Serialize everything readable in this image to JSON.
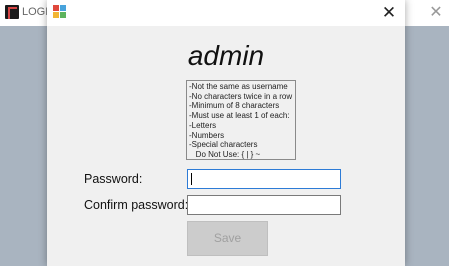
{
  "background_window": {
    "title": "LOGIN",
    "close_glyph": "✕",
    "bottom_text": "~~~"
  },
  "dialog": {
    "close_glyph": "✕",
    "username": "admin",
    "rules": [
      "-Not the same as username",
      "-No characters twice in a row",
      "-Minimum of 8 characters",
      "-Must use at least 1 of each:",
      "-Letters",
      "-Numbers",
      "-Special characters",
      "   Do Not Use: { | } ~"
    ],
    "password_label": "Password:",
    "password_value": "",
    "confirm_label": "Confirm password:",
    "confirm_value": "",
    "save_label": "Save"
  },
  "colors": {
    "desktop": "#a9b4c0",
    "dialog_bg": "#f0f0f0",
    "focus_border": "#2d7bd6",
    "disabled_button": "#cccccc"
  }
}
